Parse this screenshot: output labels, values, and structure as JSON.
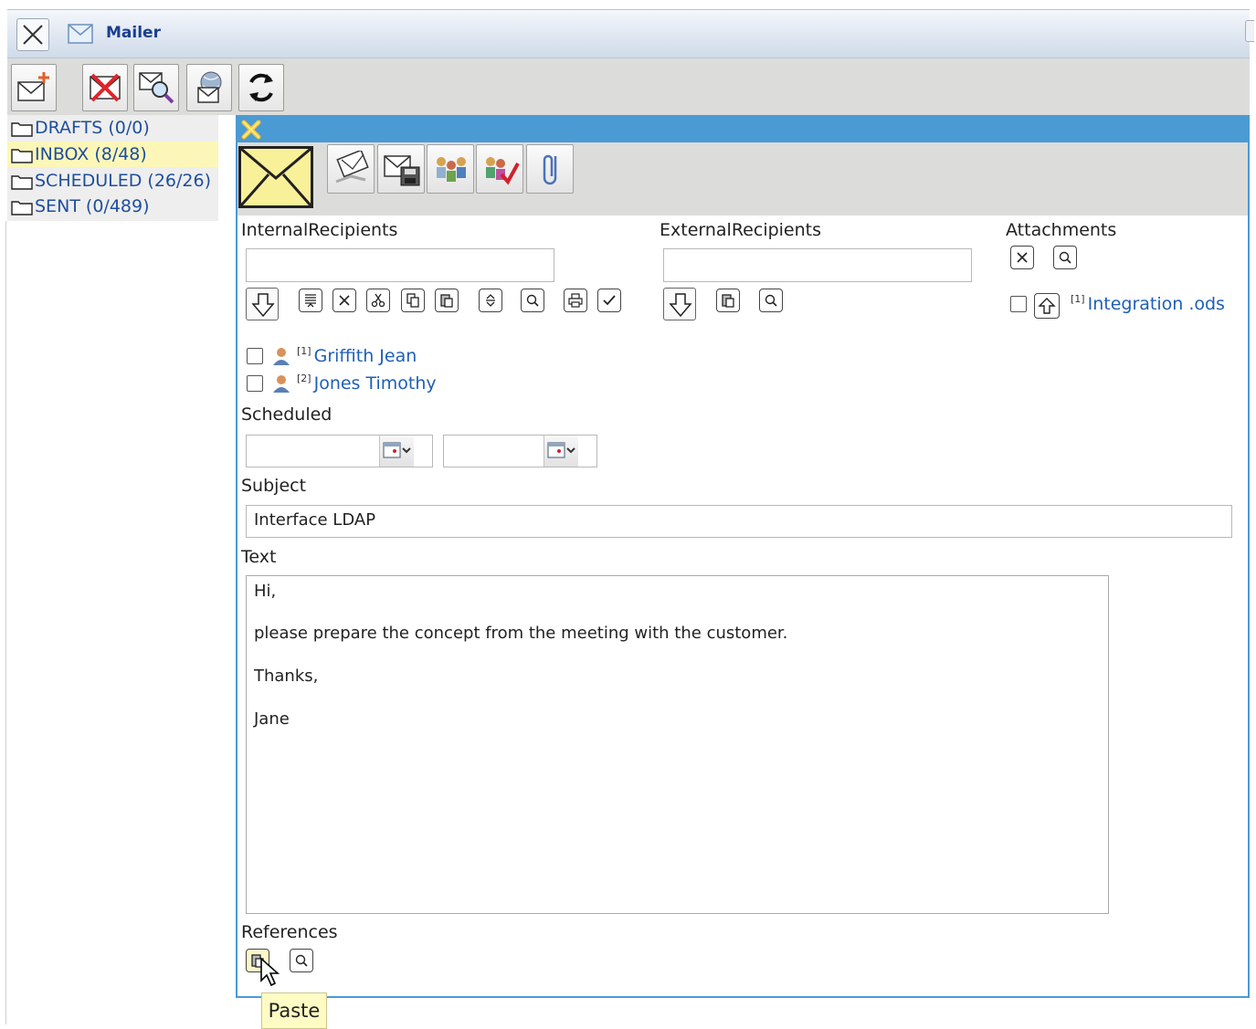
{
  "window": {
    "title": "Mailer"
  },
  "folders": [
    {
      "label": "DRAFTS (0/0)",
      "selected": false
    },
    {
      "label": "INBOX (8/48)",
      "selected": true
    },
    {
      "label": "SCHEDULED (26/26)",
      "selected": false
    },
    {
      "label": "SENT (0/489)",
      "selected": false
    }
  ],
  "compose": {
    "internal_label": "InternalRecipients",
    "external_label": "ExternalRecipients",
    "attachments_label": "Attachments",
    "attachment": {
      "index": "[1]",
      "name": "Integration .ods"
    },
    "recipients": [
      {
        "index": "[1]",
        "name": "Griffith Jean"
      },
      {
        "index": "[2]",
        "name": "Jones Timothy"
      }
    ],
    "scheduled_label": "Scheduled",
    "subject_label": "Subject",
    "subject_value": "Interface LDAP",
    "text_label": "Text",
    "text_lines": [
      "Hi,",
      "please prepare the concept from the meeting with the customer.",
      "Thanks,",
      "Jane"
    ],
    "references_label": "References"
  },
  "tooltip": "Paste",
  "colors": {
    "accent": "#4a9ad4",
    "link": "#1f5fb4",
    "selected_folder": "#fcf7b8",
    "toolbar_bg": "#dcdcda"
  }
}
